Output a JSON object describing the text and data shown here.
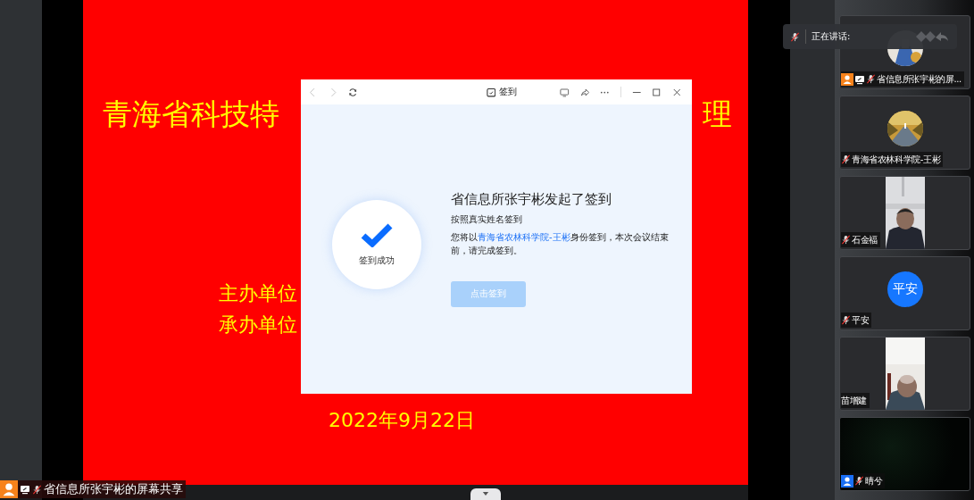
{
  "slide": {
    "title_left": "青海省科技特",
    "title_right": "理",
    "lines": [
      "主办单位",
      "承办单位"
    ],
    "date": "2022年9月22日"
  },
  "dialog": {
    "toolbar_title": "签到",
    "status": "签到成功",
    "heading": "省信息所张宇彬发起了签到",
    "subheading": "按照真实姓名签到",
    "message_before": "您将以",
    "identity": "青海省农林科学院-王彬",
    "message_after": "身份签到，本次会议结束前，请完成签到。",
    "button": {
      "label": "点击签到",
      "disabled": true
    }
  },
  "speaking": {
    "label": "正在讲话:",
    "muted": true
  },
  "participants": [
    {
      "name": "省信息所张宇彬的屏...",
      "kind": "avatar",
      "badge": {
        "color": "#f7821b"
      },
      "sharing": true,
      "muted": true
    },
    {
      "name": "青海省农林科学院-王彬",
      "kind": "avatar",
      "sharing": false,
      "muted": true
    },
    {
      "name": "石金福",
      "kind": "video",
      "sharing": false,
      "muted": true
    },
    {
      "name": "平安",
      "kind": "initials",
      "initials": "平安",
      "sharing": false,
      "muted": true
    },
    {
      "name": "苗增建",
      "kind": "video",
      "sharing": false,
      "muted": false
    },
    {
      "name": "晴兮",
      "kind": "dark",
      "badge": {
        "color": "#1a6ff5"
      },
      "sharing": false,
      "muted": true
    }
  ],
  "share_label": {
    "name": "省信息所张宇彬的屏幕共享",
    "badge": {
      "color": "#f7821b"
    },
    "sharing": true,
    "muted": true
  }
}
